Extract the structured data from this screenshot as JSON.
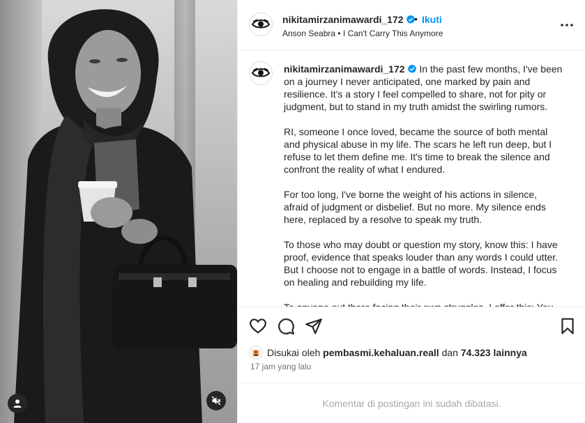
{
  "post": {
    "username": "nikitamirzanimawardi_172",
    "follow_label": "Ikuti",
    "separator": "•",
    "audio": "Anson Seabra • I Can't Carry This Anymore"
  },
  "caption": {
    "username": "nikitamirzanimawardi_172",
    "paragraphs": [
      "In the past few months, I've been on a journey I never anticipated, one marked by pain and resilience. It's a story I feel compelled to share, not for pity or judgment, but to stand in my truth amidst the swirling rumors.",
      "RI, someone I once loved, became the source of both mental and physical abuse in my life. The scars he left run deep, but I refuse to let them define me. It's time to break the silence and confront the reality of what I endured.",
      "For too long, I've borne the weight of his actions in silence, afraid of judgment or disbelief. But no more. My silence ends here, replaced by a resolve to speak my truth.",
      "To those who may doubt or question my story, know this: I have proof, evidence that speaks louder than any words I could utter. But I choose not to engage in a battle of words. Instead, I focus on healing and rebuilding my life.",
      "To anyone out there facing their own struggles, I offer this: You"
    ]
  },
  "likes": {
    "prefix": "Disukai oleh",
    "liker": "pembasmi.kehaluan.reall",
    "conjunction": "dan",
    "count": "74.323 lainnya"
  },
  "timestamp": "17 jam yang lalu",
  "comments_notice": "Komentar di postingan ini sudah dibatasi.",
  "icons": {
    "verified": "verified-badge-icon",
    "more": "more-options-icon",
    "like": "heart-icon",
    "comment": "comment-icon",
    "share": "send-icon",
    "save": "bookmark-icon",
    "user_tag": "user-tag-icon",
    "mute": "audio-muted-icon"
  },
  "colors": {
    "accent": "#0095f6",
    "verified": "#0095f6",
    "muted_text": "#737373",
    "disabled_text": "#a8a8a8",
    "border": "#efefef"
  }
}
